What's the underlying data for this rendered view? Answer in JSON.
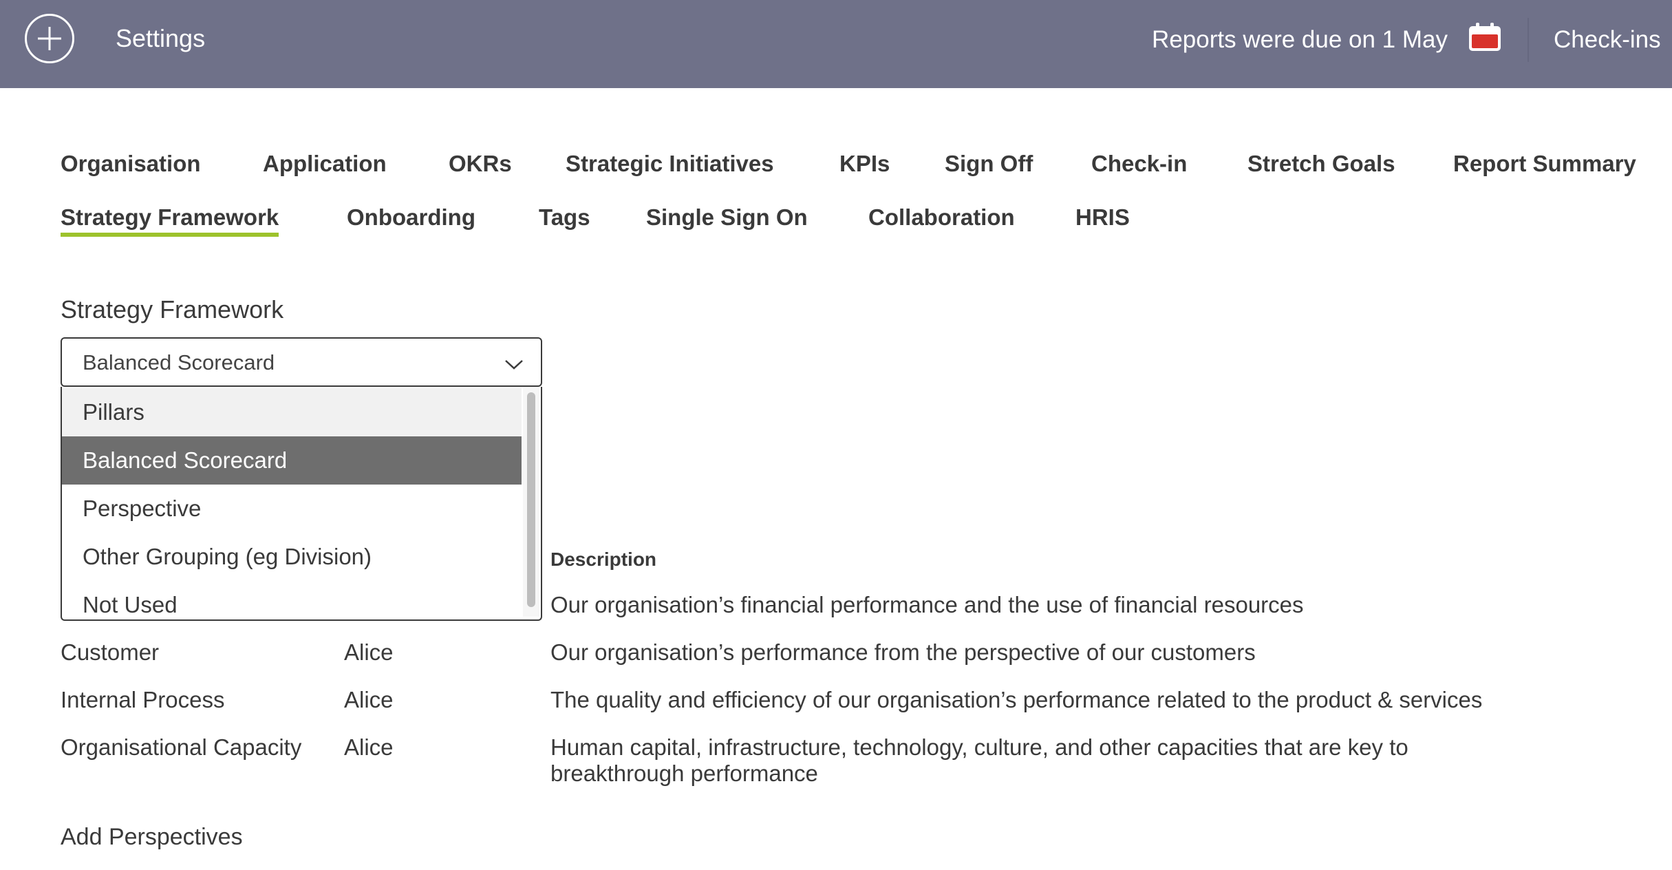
{
  "topbar": {
    "title": "Settings",
    "due_text": "Reports were due on 1 May",
    "checkins_label": "Check-ins",
    "accent_color": "#6f7189",
    "calendar_color": "#d8322b"
  },
  "tabs_row1": [
    "Organisation",
    "Application",
    "OKRs",
    "Strategic Initiatives",
    "KPIs",
    "Sign Off",
    "Check-in",
    "Stretch Goals",
    "Report Summary"
  ],
  "tabs_row2": [
    "Strategy Framework",
    "Onboarding",
    "Tags",
    "Single Sign On",
    "Collaboration",
    "HRIS"
  ],
  "active_tab": "Strategy Framework",
  "active_tab_color": "#9dc22b",
  "framework": {
    "section_title": "Strategy Framework",
    "selected_value": "Balanced Scorecard",
    "options": [
      "Pillars",
      "Balanced Scorecard",
      "Perspective",
      "Other Grouping (eg Division)",
      "Not Used"
    ]
  },
  "table": {
    "description_header": "Description",
    "rows": [
      {
        "name": "",
        "owner": "",
        "description": "Our organisation’s financial performance and the use of financial resources"
      },
      {
        "name": "Customer",
        "owner": "Alice",
        "description": "Our organisation’s performance from the perspective of our customers"
      },
      {
        "name": "Internal Process",
        "owner": "Alice",
        "description": "The quality and efficiency of our organisation’s performance related to the product & services"
      },
      {
        "name": "Organisational Capacity",
        "owner": "Alice",
        "description": "Human capital, infrastructure, technology, culture, and other capacities that are key to breakthrough performance"
      }
    ]
  },
  "add_link": "Add Perspectives"
}
